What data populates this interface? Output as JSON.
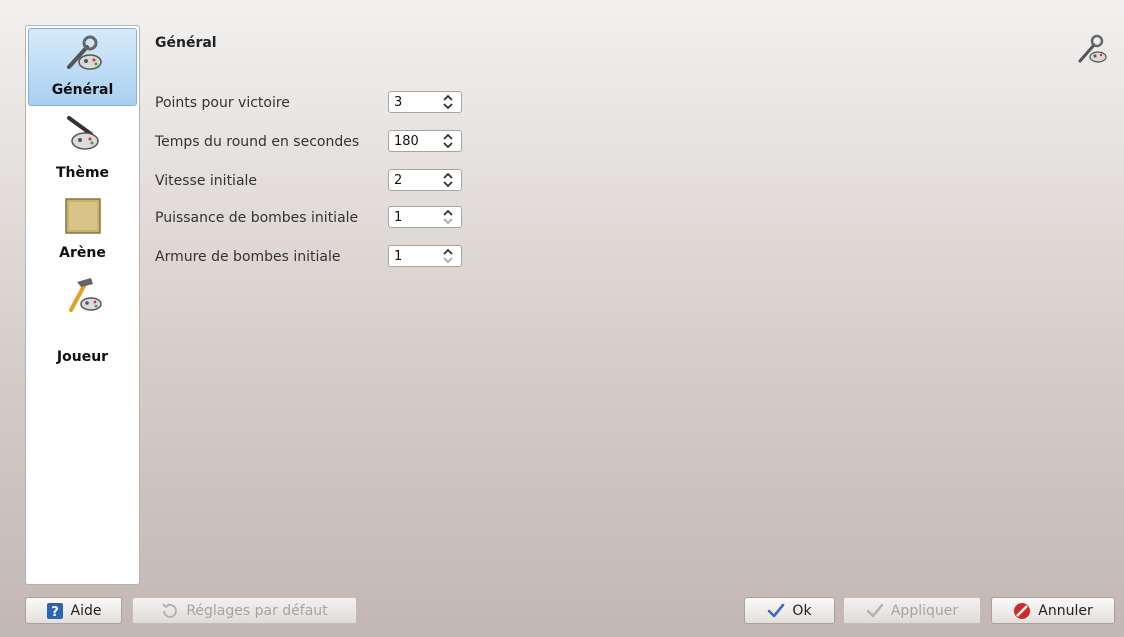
{
  "sidebar": {
    "items": [
      {
        "label": "Général",
        "icon": "wrench-gamepad-icon",
        "active": true
      },
      {
        "label": "Thème",
        "icon": "brush-gamepad-icon",
        "active": false
      },
      {
        "label": "Arène",
        "icon": "arena-tile-icon",
        "active": false
      },
      {
        "label": "Joueur",
        "icon": "hammer-gamepad-icon",
        "active": false
      }
    ]
  },
  "page": {
    "title": "Général",
    "title_icon": "wrench-gamepad-icon"
  },
  "settings": [
    {
      "label": "Points pour victoire",
      "value": "3"
    },
    {
      "label": "Temps du round en secondes",
      "value": "180"
    },
    {
      "label": "Vitesse initiale",
      "value": "2"
    },
    {
      "label": "Puissance de bombes initiale",
      "value": "1"
    },
    {
      "label": "Armure de bombes initiale",
      "value": "1"
    }
  ],
  "buttons": {
    "help": "Aide",
    "defaults": "Réglages par défaut",
    "ok": "Ok",
    "apply": "Appliquer",
    "cancel": "Annuler"
  },
  "colors": {
    "active_item": "#a9d0f1",
    "ok_check": "#3d6fb6",
    "cancel_red": "#d22a2a",
    "help_blue": "#2d63b7"
  }
}
